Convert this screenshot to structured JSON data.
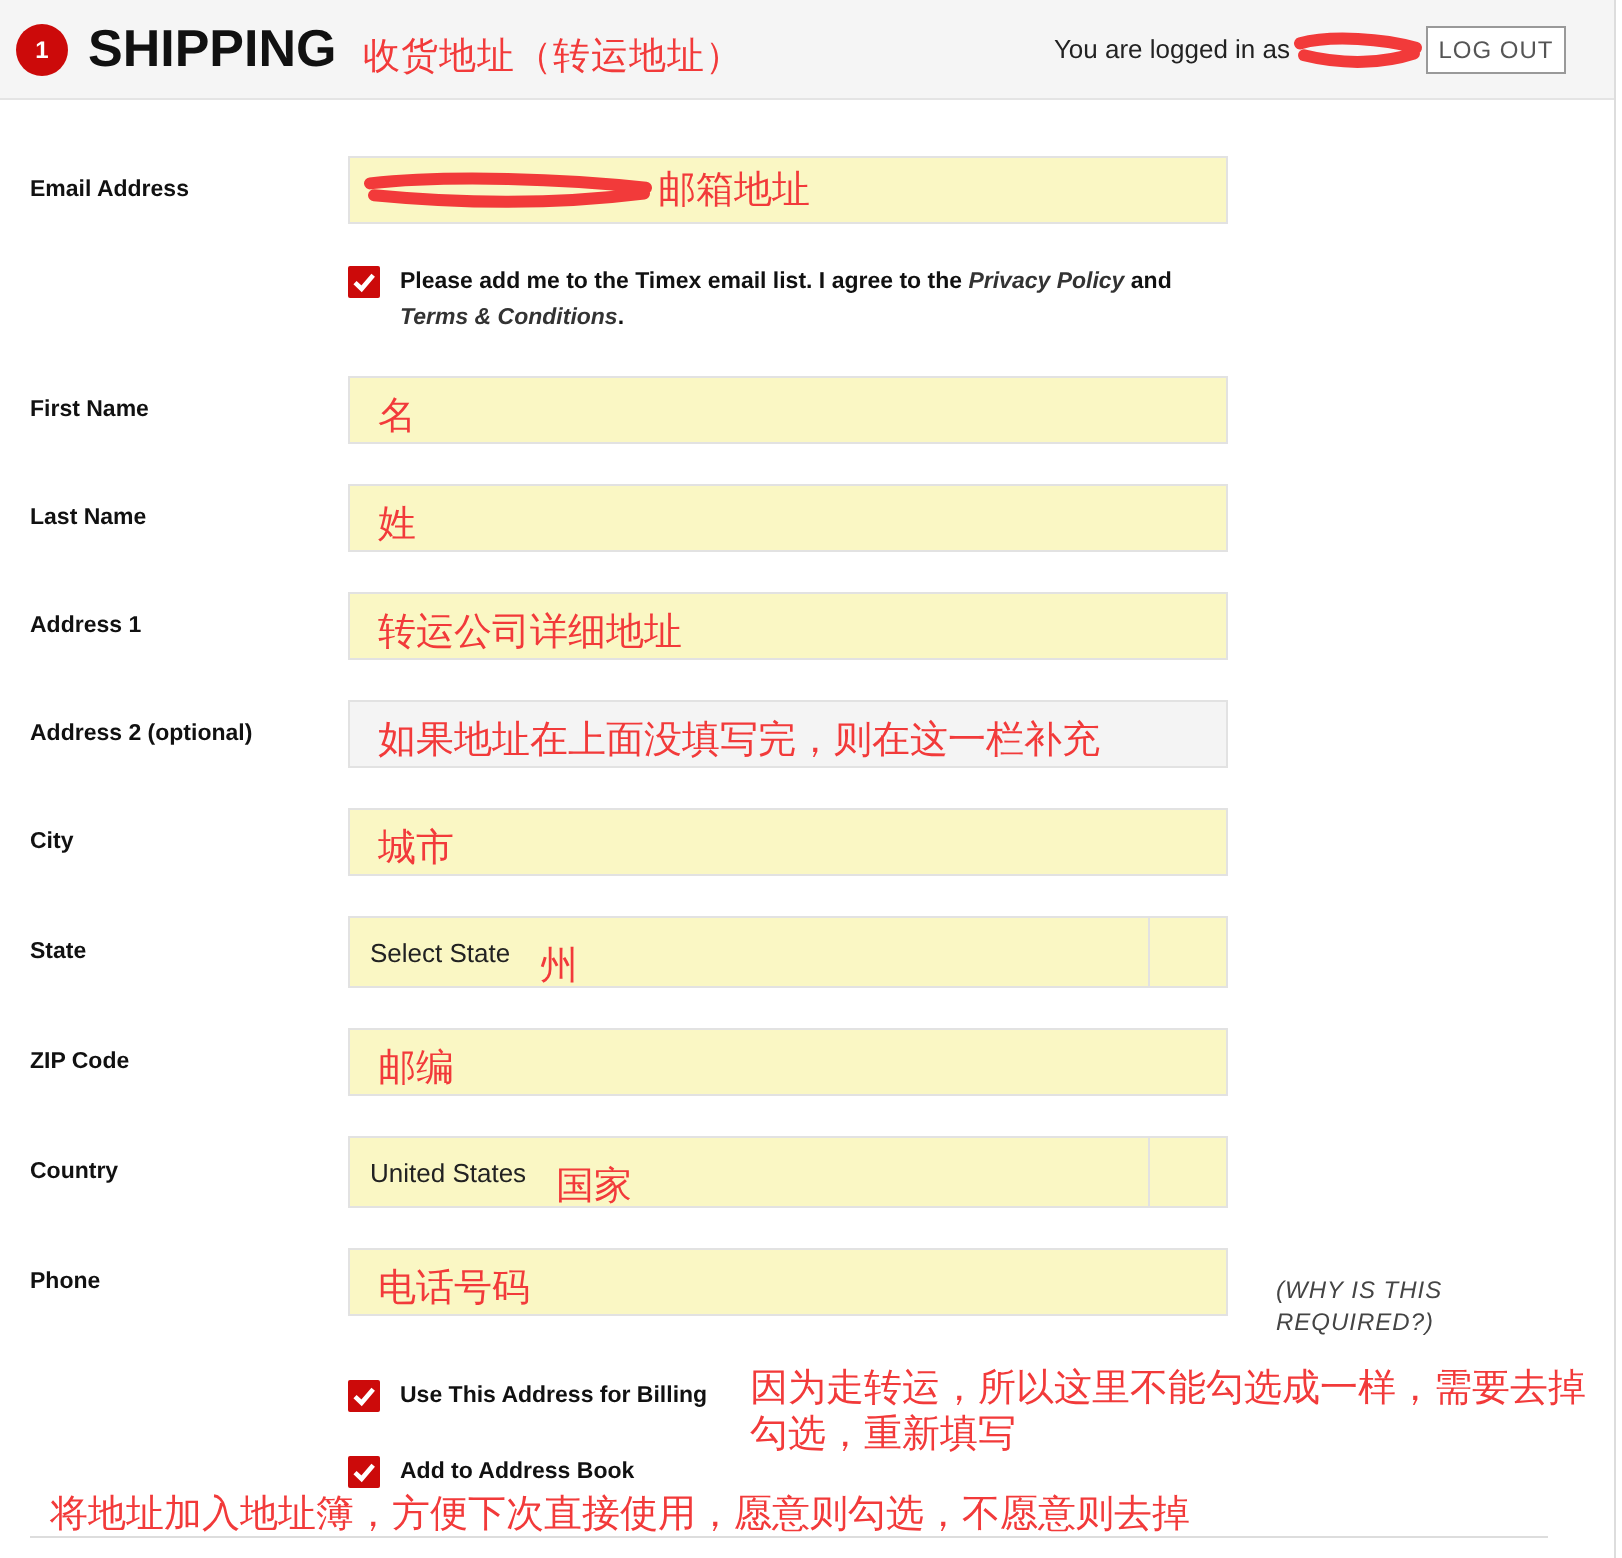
{
  "header": {
    "step": "1",
    "title": "SHIPPING",
    "annotation": "收货地址（转运地址）",
    "login": {
      "text": "You are logged in as",
      "redacted": true
    },
    "logout_button": "LOG OUT"
  },
  "form": {
    "items": [
      {
        "kind": "text",
        "label": "Email Address",
        "autofilled": true,
        "redacted": true,
        "annotation": "邮箱地址"
      },
      {
        "kind": "checkbox",
        "label": "Please add me to the Timex email list. I agree to the *Privacy Policy* and *Terms & Conditions*.",
        "checked": true
      },
      {
        "kind": "text",
        "label": "First Name",
        "autofilled": true,
        "redacted": false,
        "annotation": "名"
      },
      {
        "kind": "text",
        "label": "Last Name",
        "autofilled": true,
        "redacted": false,
        "annotation": "姓"
      },
      {
        "kind": "text",
        "label": "Address 1",
        "autofilled": true,
        "redacted": false,
        "annotation": "转运公司详细地址"
      },
      {
        "kind": "text",
        "label": "Address 2 (optional)",
        "autofilled": false,
        "redacted": false,
        "annotation": "如果地址在上面没填写完，则在这一栏补充"
      },
      {
        "kind": "text",
        "label": "City",
        "autofilled": true,
        "redacted": false,
        "annotation": "城市"
      },
      {
        "kind": "select",
        "label": "State",
        "autofilled": true,
        "value": "Select State",
        "annotation": "州"
      },
      {
        "kind": "text",
        "label": "ZIP Code",
        "autofilled": true,
        "redacted": false,
        "annotation": "邮编"
      },
      {
        "kind": "select",
        "label": "Country",
        "autofilled": true,
        "value": "United States",
        "annotation": "国家"
      },
      {
        "kind": "text",
        "label": "Phone",
        "autofilled": true,
        "redacted": false,
        "annotation": "电话号码",
        "note": "(WHY IS THIS REQUIRED?)"
      },
      {
        "kind": "checkbox",
        "label": "Use This Address for Billing",
        "checked": true,
        "annotation": "因为走转运，所以这里不能勾选成一样，需要去掉勾选，重新填写"
      },
      {
        "kind": "checkbox",
        "label": "Add to Address Book",
        "checked": true
      }
    ]
  },
  "note": "将地址加入地址簿，方便下次直接使用，愿意则勾选，不愿意则去掉"
}
